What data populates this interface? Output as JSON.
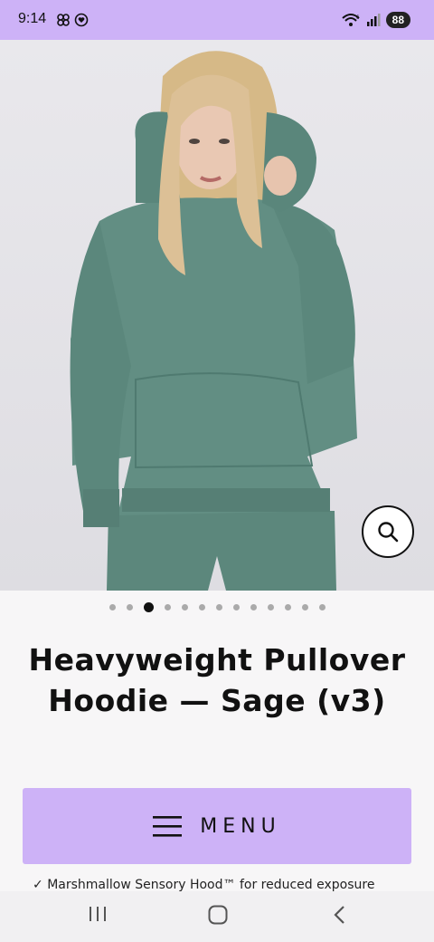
{
  "status_bar": {
    "time": "9:14",
    "battery": "88",
    "wifi_label": "6"
  },
  "product": {
    "title": "Heavyweight Pullover Hoodie — Sage (v3)",
    "image_count": 13,
    "active_image_index": 2
  },
  "menu": {
    "label": "MENU"
  },
  "description": {
    "bullet_partial": "Marshmallow Sensory Hood™ for reduced exposure"
  },
  "colors": {
    "accent": "#cdb2f7",
    "hoodie": "#5e8a7f"
  }
}
